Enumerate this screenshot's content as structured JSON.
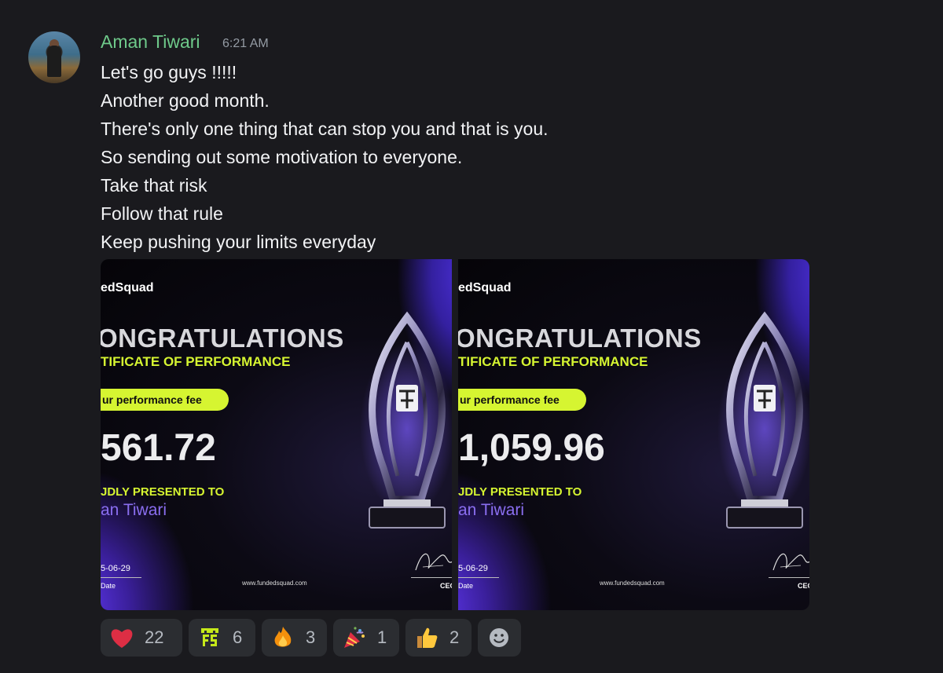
{
  "message": {
    "author": "Aman Tiwari",
    "time": "6:21 AM",
    "lines": [
      "Let's go guys !!!!!",
      "Another good month.",
      "There's only one thing that can stop you and that is you.",
      "So sending out some motivation to everyone.",
      "Take that risk",
      "Follow that rule",
      "Keep pushing your limits everyday"
    ]
  },
  "attachments": [
    {
      "brand": "edSquad",
      "heading": "ONGRATULATIONS",
      "subheading": "TIFICATE OF PERFORMANCE",
      "pill": "ur performance fee",
      "amount": "561.72",
      "presented": "JDLY PRESENTED TO",
      "recipient": "an Tiwari",
      "date": "5-06-29",
      "date_label": "Date",
      "website": "www.fundedsquad.com",
      "ceo_label": "CEO"
    },
    {
      "brand": "edSquad",
      "heading": "ONGRATULATIONS",
      "subheading": "TIFICATE OF PERFORMANCE",
      "pill": "ur performance fee",
      "amount": "1,059.96",
      "presented": "JDLY PRESENTED TO",
      "recipient": "an Tiwari",
      "date": "5-06-29",
      "date_label": "Date",
      "website": "www.fundedsquad.com",
      "ceo_label": "CEO"
    }
  ],
  "reactions": [
    {
      "emoji": "heart-icon",
      "count": "22"
    },
    {
      "emoji": "fundedsquad-logo-icon",
      "count": "6"
    },
    {
      "emoji": "fire-icon",
      "count": "3"
    },
    {
      "emoji": "party-popper-icon",
      "count": "1"
    },
    {
      "emoji": "thumbs-up-icon",
      "count": "2"
    },
    {
      "emoji": "add-reaction-icon",
      "count": ""
    }
  ],
  "colors": {
    "username": "#6ec98a",
    "accent_lime": "#d6f531",
    "accent_purple": "#8a6ef0"
  }
}
